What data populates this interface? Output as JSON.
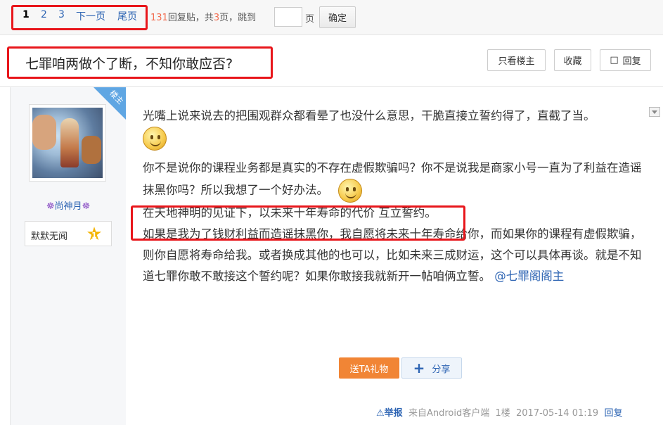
{
  "pager": {
    "pages": [
      "1",
      "2",
      "3"
    ],
    "next": "下一页",
    "last": "尾页",
    "reply_count": "131",
    "reply_suffix": "回复贴，共",
    "page_total": "3",
    "page_suffix": "页，跳到",
    "jump_after": "页",
    "confirm": "确定"
  },
  "thread": {
    "title": "七罪咱两做个了断，不知你敢应否?",
    "only_op": "只看楼主",
    "favorite": "收藏",
    "reply": "回复"
  },
  "post": {
    "badge": "楼主",
    "username": "尚神月",
    "username_symbol": "☸",
    "rank_name": "默默无闻",
    "rank_level": "1",
    "lines": [
      "光嘴上说来说去的把围观群众都看晕了也没什么意思，干脆直接立誓约得了，直截了当。",
      "你不是说你的课程业务都是真实的不存在虚假欺骗吗？你不是说我是商家小号一直为了利益在造谣抹黑你吗？所以我想了一个好办法。",
      "在天地神明的见证下，以未来十年寿命的代价 互立誓约。",
      "如果是我为了钱财利益而造谣抹黑你，我自愿将未来十年寿命给你，而如果你的课程有虚假欺骗，则你自愿将寿命给我。或者换成其他的也可以，比如未来三成财运，这个可以具体再谈。就是不知道七罪你敢不敢接这个誓约呢？如果你敢接我就新开一帖咱俩立誓。",
      "@七罪阁阁主"
    ],
    "gift": "送TA礼物",
    "share": "分享",
    "report": "举报",
    "source": "来自Android客户端",
    "floor": "1楼",
    "time": "2017-05-14 01:19",
    "reply": "回复"
  },
  "colors": {
    "link": "#2d64b3",
    "highlight": "#e8161b",
    "accent_orange": "#f18535"
  }
}
